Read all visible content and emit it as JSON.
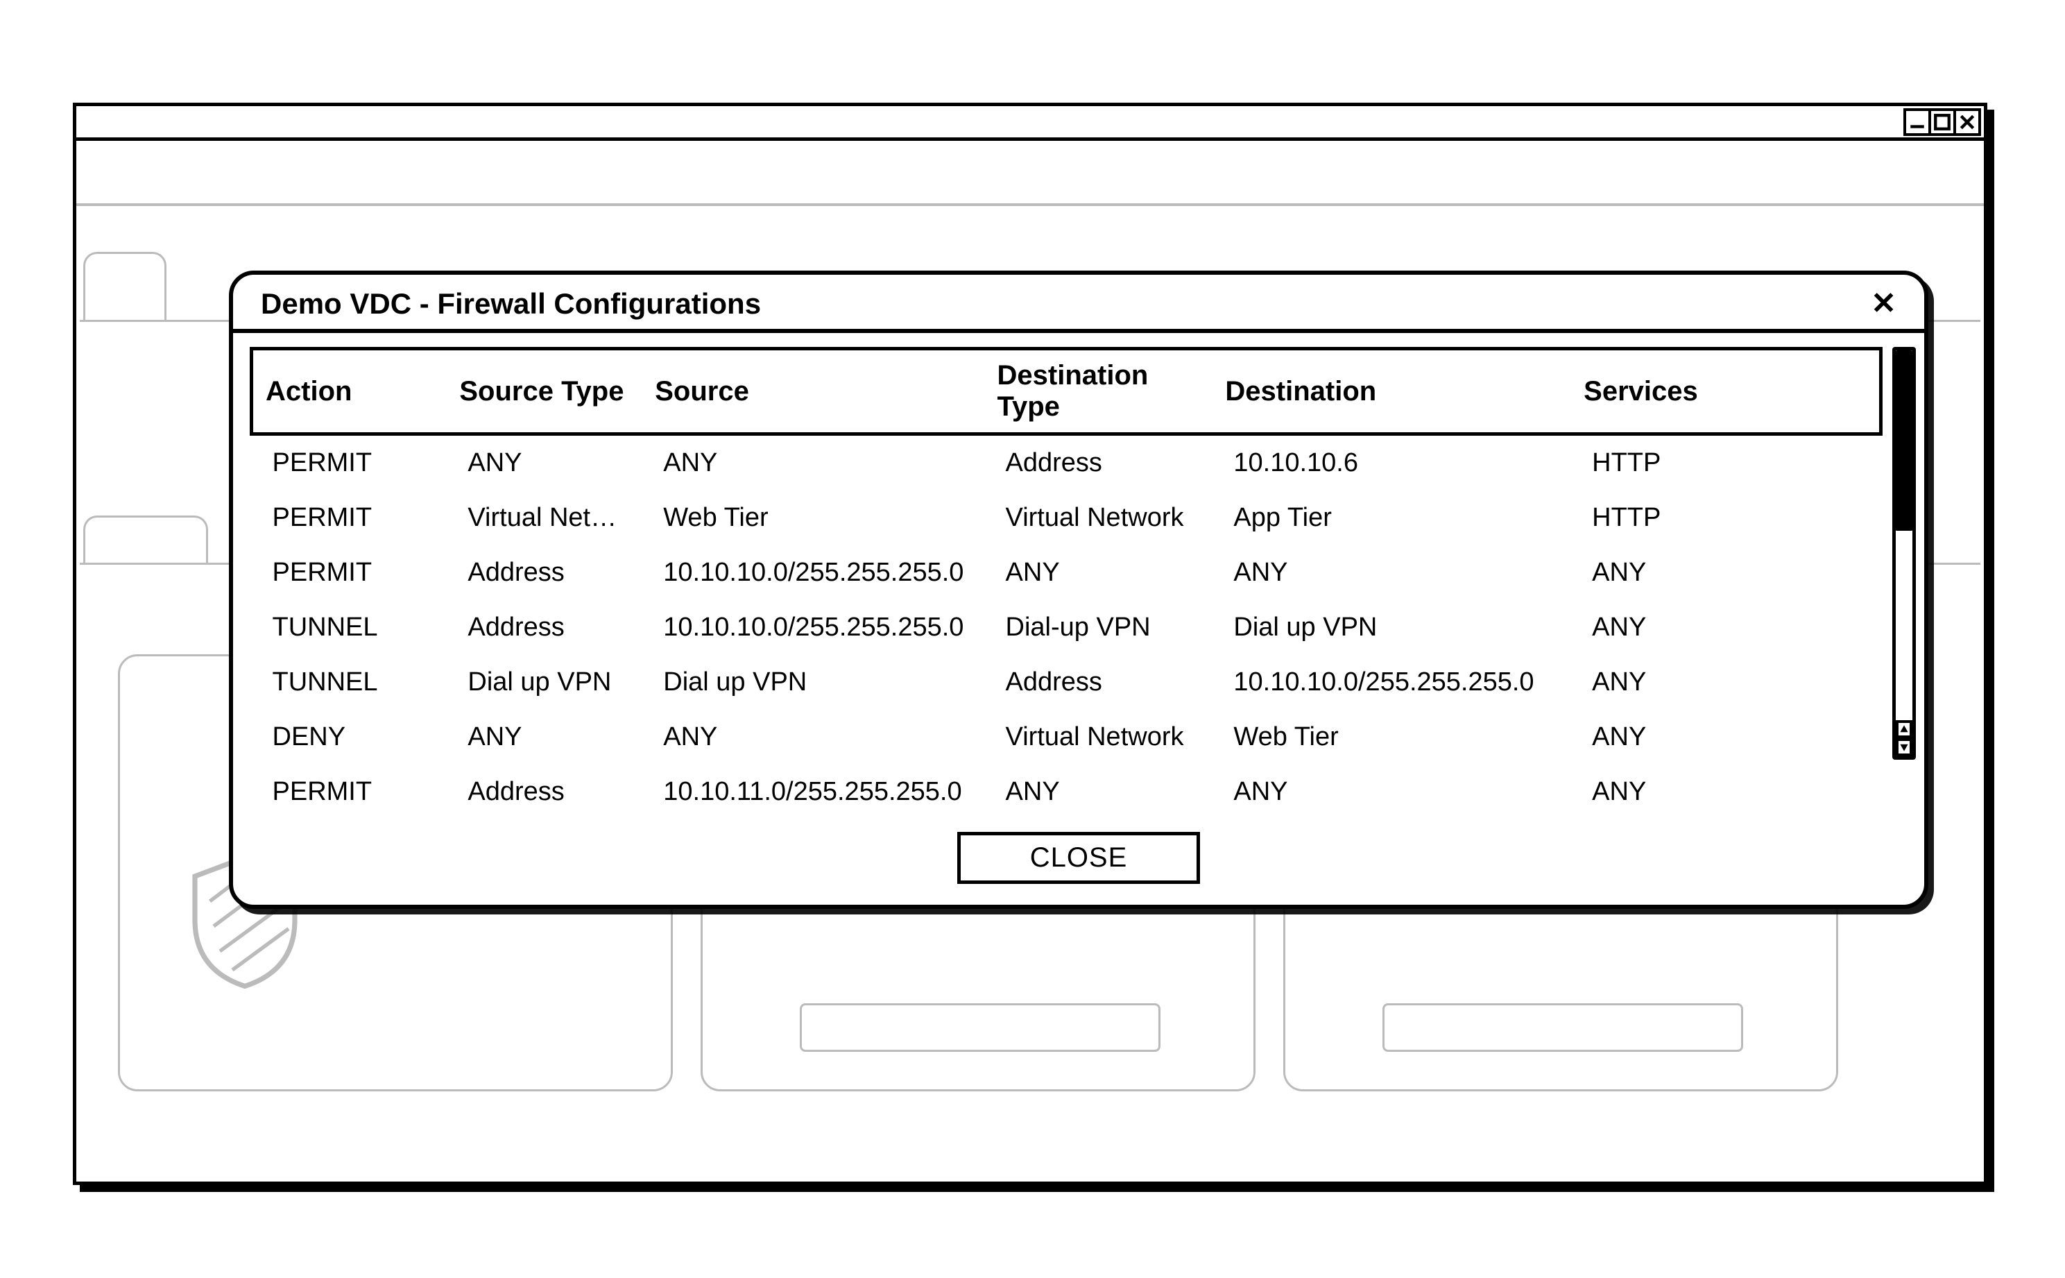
{
  "dialog": {
    "title": "Demo VDC - Firewall Configurations",
    "close_button_label": "CLOSE",
    "columns": {
      "action": "Action",
      "source_type": "Source Type",
      "source": "Source",
      "destination_type": "Destination Type",
      "destination": "Destination",
      "services": "Services"
    },
    "rows": [
      {
        "action": "PERMIT",
        "source_type": "ANY",
        "source": "ANY",
        "destination_type": "Address",
        "destination": "10.10.10.6",
        "services": "HTTP"
      },
      {
        "action": "PERMIT",
        "source_type": "Virtual Network",
        "source": "Web Tier",
        "destination_type": "Virtual Network",
        "destination": "App Tier",
        "services": "HTTP"
      },
      {
        "action": "PERMIT",
        "source_type": "Address",
        "source": "10.10.10.0/255.255.255.0",
        "destination_type": "ANY",
        "destination": "ANY",
        "services": "ANY"
      },
      {
        "action": "TUNNEL",
        "source_type": "Address",
        "source": "10.10.10.0/255.255.255.0",
        "destination_type": "Dial-up VPN",
        "destination": "Dial up VPN",
        "services": "ANY"
      },
      {
        "action": "TUNNEL",
        "source_type": "Dial up VPN",
        "source": "Dial up VPN",
        "destination_type": "Address",
        "destination": "10.10.10.0/255.255.255.0",
        "services": "ANY"
      },
      {
        "action": "DENY",
        "source_type": "ANY",
        "source": "ANY",
        "destination_type": "Virtual Network",
        "destination": "Web Tier",
        "services": "ANY"
      },
      {
        "action": "PERMIT",
        "source_type": "Address",
        "source": "10.10.11.0/255.255.255.0",
        "destination_type": "ANY",
        "destination": "ANY",
        "services": "ANY"
      }
    ]
  }
}
